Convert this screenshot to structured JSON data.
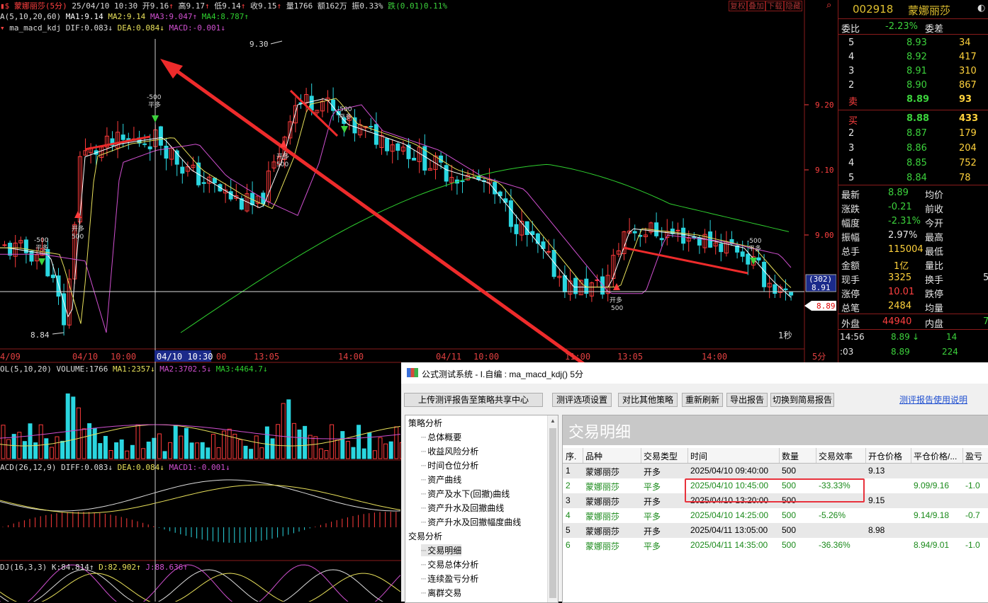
{
  "stock_header": {
    "name": "蒙娜丽莎(5分)",
    "datetime": "25/04/10 10:30",
    "open": "开9.16",
    "high": "高9.17",
    "low": "低9.14",
    "close": "收9.15",
    "volume": "量1766",
    "amount": "额162万",
    "amplitude": "振0.33%",
    "change": "跌(0.01)0.11%",
    "buttons": [
      "复权",
      "叠加",
      "下载",
      "隐藏"
    ]
  },
  "ma_legend": {
    "prefix": "A(5,10,20,60)",
    "ma1": "MA1:9.14",
    "ma2": "MA2:9.14",
    "ma3": "MA3:9.047",
    "ma4": "MA4:8.787"
  },
  "macd_kdj_legend": {
    "name": "ma_macd_kdj",
    "dif": "DIF:0.083",
    "dea": "DEA:0.084",
    "macd": "MACD:-0.001"
  },
  "price_labels": {
    "high_label": "9.30",
    "low_label": "8.84",
    "ticks": [
      "9.20",
      "9.10",
      "9.00"
    ],
    "cursor_label": "8.91",
    "cursor_count": "(302)",
    "last_label": "8.89",
    "seconds": "1秒"
  },
  "signals": [
    {
      "type": "-500",
      "text": "平多"
    },
    {
      "type": "-500",
      "text": "平多"
    },
    {
      "type": "-500",
      "text": "平多"
    },
    {
      "type": "-500",
      "text": "平多"
    },
    {
      "type": "开多",
      "text": "500"
    },
    {
      "type": "开多",
      "text": "500"
    },
    {
      "type": "开多",
      "text": "500"
    }
  ],
  "time_axis": [
    "4/09",
    "04/10",
    "10:00",
    "04/10 10:30",
    "00",
    "13:05",
    "14:00",
    "04/11",
    "10:00",
    "11:00",
    "13:05",
    "14:00",
    "5分"
  ],
  "volume_legend": {
    "prefix": "OL(5,10,20)",
    "volume": "VOLUME:1766",
    "ma1": "MA1:2357",
    "ma2": "MA2:3702.5",
    "ma3": "MA3:4464.7"
  },
  "macd_legend": {
    "prefix": "ACD(26,12,9)",
    "diff": "DIFF:0.083",
    "dea": "DEA:0.084",
    "macd": "MACD1:-0.001"
  },
  "kdj_legend": {
    "prefix": "DJ(16,3,3)",
    "k": "K:84.814",
    "d": "D:82.902",
    "j": "J:88.636"
  },
  "quote": {
    "code": "002918",
    "name": "蒙娜丽莎",
    "weibi_label": "委比",
    "weibi": "-2.23%",
    "weicha_label": "委差",
    "sell": [
      {
        "n": "5",
        "p": "8.93",
        "v": "34"
      },
      {
        "n": "4",
        "p": "8.92",
        "v": "417"
      },
      {
        "n": "3",
        "p": "8.91",
        "v": "310"
      },
      {
        "n": "2",
        "p": "8.90",
        "v": "867"
      },
      {
        "n": "卖",
        "p": "8.89",
        "v": "93"
      }
    ],
    "buy": [
      {
        "n": "买",
        "p": "8.88",
        "v": "433"
      },
      {
        "n": "2",
        "p": "8.87",
        "v": "179"
      },
      {
        "n": "3",
        "p": "8.86",
        "v": "204"
      },
      {
        "n": "4",
        "p": "8.85",
        "v": "752"
      },
      {
        "n": "5",
        "p": "8.84",
        "v": "78"
      }
    ],
    "stats": [
      {
        "l": "最新",
        "v": "8.89",
        "l2": "均价",
        "v2": ""
      },
      {
        "l": "涨跌",
        "v": "-0.21",
        "l2": "前收",
        "v2": ""
      },
      {
        "l": "幅度",
        "v": "-2.31%",
        "l2": "今开",
        "v2": ""
      },
      {
        "l": "振幅",
        "v": "2.97%",
        "l2": "最高",
        "v2": ""
      },
      {
        "l": "总手",
        "v": "115004",
        "l2": "最低",
        "v2": ""
      },
      {
        "l": "金额",
        "v": "1亿",
        "l2": "量比",
        "v2": ""
      },
      {
        "l": "现手",
        "v": "3325",
        "l2": "换手",
        "v2": "5"
      },
      {
        "l": "涨停",
        "v": "10.01",
        "l2": "跌停",
        "v2": ""
      },
      {
        "l": "总笔",
        "v": "2484",
        "l2": "均量",
        "v2": ""
      }
    ],
    "outer_label": "外盘",
    "outer": "44940",
    "inner_label": "内盘",
    "inner": "7",
    "ticks": [
      {
        "t": "14:56",
        "p": "8.89",
        "arrow": "↓",
        "v": "14"
      },
      {
        "t": ":03",
        "p": "8.89",
        "arrow": "",
        "v": "224"
      }
    ]
  },
  "dialog": {
    "title": "公式测试系统 - I.自编 : ma_macd_kdj() 5分",
    "buttons": [
      "上传测评报告至策略共享中心",
      "测评选项设置",
      "对比其他策略",
      "重新刷新",
      "导出报告",
      "切换到简易报告"
    ],
    "help_link": "测评报告使用说明",
    "tree": [
      {
        "label": "策略分析",
        "level": 0
      },
      {
        "label": "总体概要",
        "level": 1
      },
      {
        "label": "收益风险分析",
        "level": 1
      },
      {
        "label": "时间仓位分析",
        "level": 1
      },
      {
        "label": "资产曲线",
        "level": 1
      },
      {
        "label": "资产及水下(回撤)曲线",
        "level": 1
      },
      {
        "label": "资产升水及回撤曲线",
        "level": 1
      },
      {
        "label": "资产升水及回撤幅度曲线",
        "level": 1
      },
      {
        "label": "交易分析",
        "level": 0
      },
      {
        "label": "交易明细",
        "level": 1
      },
      {
        "label": "交易总体分析",
        "level": 1
      },
      {
        "label": "连续盈亏分析",
        "level": 1
      },
      {
        "label": "离群交易",
        "level": 1
      }
    ],
    "banner": "交易明细",
    "columns": [
      "序.",
      "品种",
      "交易类型",
      "时间",
      "数量",
      "交易效率",
      "开仓价格",
      "平仓价格/...",
      "盈亏"
    ],
    "rows": [
      {
        "id": "1",
        "sym": "蒙娜丽莎",
        "type": "开多",
        "time": "2025/04/10 09:40:00",
        "qty": "500",
        "eff": "",
        "open": "9.13",
        "close": "",
        "pl": ""
      },
      {
        "id": "2",
        "sym": "蒙娜丽莎",
        "type": "平多",
        "time": "2025/04/10 10:45:00",
        "qty": "500",
        "eff": "-33.33%",
        "open": "",
        "close": "9.09/9.16",
        "pl": "-1.0"
      },
      {
        "id": "3",
        "sym": "蒙娜丽莎",
        "type": "开多",
        "time": "2025/04/10 13:20:00",
        "qty": "500",
        "eff": "",
        "open": "9.15",
        "close": "",
        "pl": ""
      },
      {
        "id": "4",
        "sym": "蒙娜丽莎",
        "type": "平多",
        "time": "2025/04/10 14:25:00",
        "qty": "500",
        "eff": "-5.26%",
        "open": "",
        "close": "9.14/9.18",
        "pl": "-0.7"
      },
      {
        "id": "5",
        "sym": "蒙娜丽莎",
        "type": "开多",
        "time": "2025/04/11 13:05:00",
        "qty": "500",
        "eff": "",
        "open": "8.98",
        "close": "",
        "pl": ""
      },
      {
        "id": "6",
        "sym": "蒙娜丽莎",
        "type": "平多",
        "time": "2025/04/11 14:35:00",
        "qty": "500",
        "eff": "-36.36%",
        "open": "",
        "close": "8.94/9.01",
        "pl": "-1.0"
      }
    ]
  },
  "colors": {
    "up": "#ff3b3b",
    "down": "#2ad6e0",
    "ma1": "#ffffff",
    "ma2": "#e8e05a",
    "ma3": "#d050d0",
    "ma4": "#2fd02f",
    "annotation": "#ee2b2b"
  }
}
